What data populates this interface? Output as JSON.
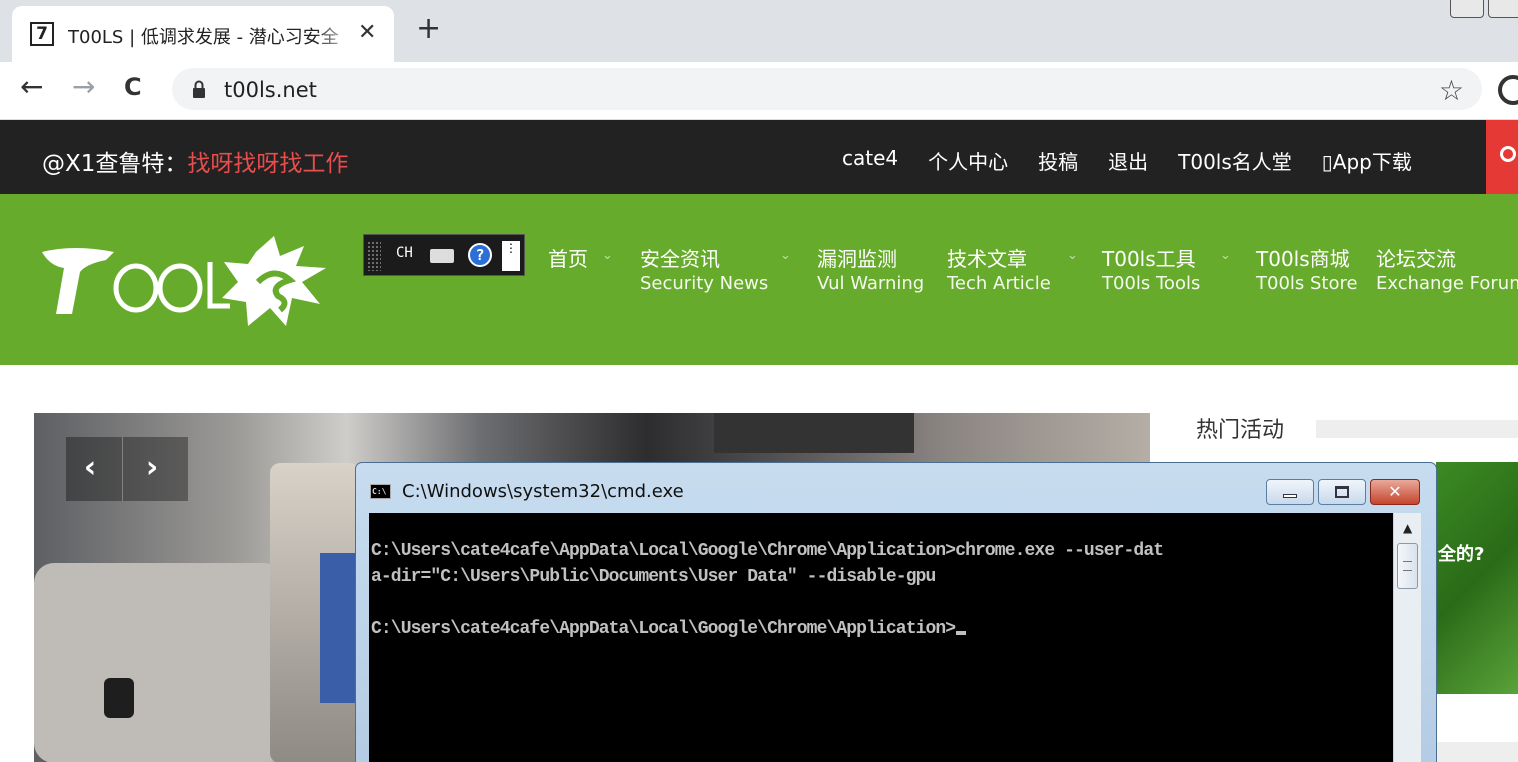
{
  "browser": {
    "tab_title": "T00LS | 低调求发展 - 潜心习安全",
    "tab_favicon": "7",
    "tab_close": "✕",
    "new_tab": "+",
    "back": "←",
    "forward": "→",
    "reload": "C",
    "url": "t00ls.net",
    "star": "☆"
  },
  "site": {
    "greeting_prefix": "@X1查鲁特：",
    "greeting_highlight": "找呀找呀找工作",
    "top_links": [
      "cate4",
      "个人中心",
      "投稿",
      "退出",
      "T00ls名人堂",
      "▯App下载"
    ],
    "nav": [
      {
        "cn": "首页",
        "en": "",
        "caret": "⌄"
      },
      {
        "cn": "安全资讯",
        "en": "Security News",
        "caret": "⌄"
      },
      {
        "cn": "漏洞监测",
        "en": "Vul Warning",
        "caret": ""
      },
      {
        "cn": "技术文章",
        "en": "Tech Article",
        "caret": "⌄"
      },
      {
        "cn": "T00ls工具",
        "en": "T00ls Tools",
        "caret": "⌄"
      },
      {
        "cn": "T00ls商城",
        "en": "T00ls Store",
        "caret": ""
      },
      {
        "cn": "论坛交流",
        "en": "Exchange Forum",
        "caret": ""
      }
    ],
    "slider_prev": "‹",
    "slider_next": "›",
    "side_title": "热门活动",
    "side_banner_text": "全的?"
  },
  "ime": {
    "lang": "CH",
    "help": "?",
    "opts": "⋮"
  },
  "cmd": {
    "title": "C:\\Windows\\system32\\cmd.exe",
    "icon_text": "C:\\",
    "close_glyph": "✕",
    "lines": [
      "C:\\Users\\cate4cafe\\AppData\\Local\\Google\\Chrome\\Application>chrome.exe --user-dat",
      "a-dir=\"C:\\Users\\Public\\Documents\\User Data\" --disable-gpu",
      "",
      "C:\\Users\\cate4cafe\\AppData\\Local\\Google\\Chrome\\Application>"
    ],
    "scroll_up": "▲"
  }
}
